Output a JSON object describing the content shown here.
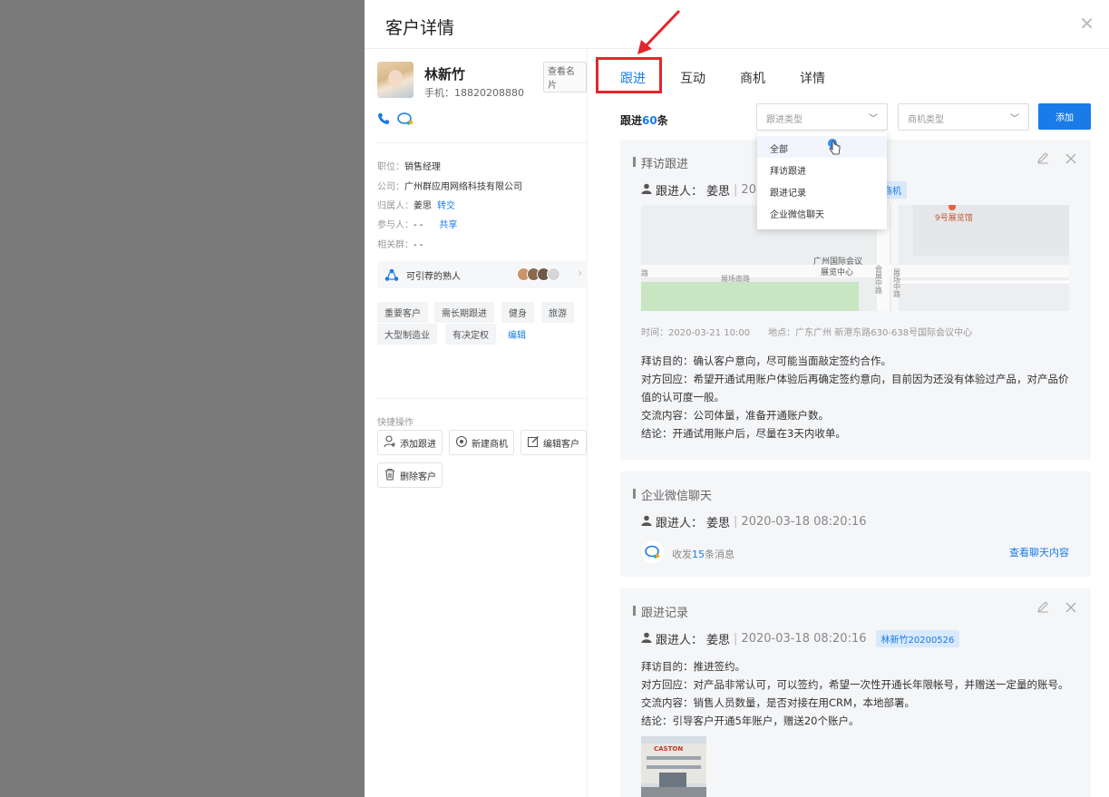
{
  "drawer": {
    "title": "客户详情",
    "close_icon": "close-icon"
  },
  "customer": {
    "name": "林新竹",
    "phone": "手机：18820208880",
    "view_card": "查看名片",
    "fields": [
      {
        "label": "职位：",
        "value": "销售经理"
      },
      {
        "label": "公司：",
        "value": "广州群应用网络科技有限公司"
      },
      {
        "label": "归属人：",
        "value": "姜思",
        "link": "转交"
      },
      {
        "label": "参与人：",
        "value": "- -",
        "link": "共享"
      },
      {
        "label": "相关群：",
        "value": "- -"
      }
    ],
    "recommend_label": "可引荐的熟人",
    "tags": [
      "重要客户",
      "需长期跟进",
      "健身",
      "旅游",
      "大型制造业",
      "有决定权"
    ],
    "tags_edit": "编辑",
    "quick_title": "快捷操作",
    "quick_actions": [
      "添加跟进",
      "新建商机",
      "编辑客户",
      "删除客户"
    ]
  },
  "tabs": [
    "跟进",
    "互动",
    "商机",
    "详情"
  ],
  "follow_count": {
    "prefix": "跟进",
    "num": "60",
    "suffix": "条"
  },
  "filters": {
    "type_placeholder": "跟进类型",
    "biz_placeholder": "商机类型",
    "add_label": "添加",
    "dropdown_options": [
      "全部",
      "拜访跟进",
      "跟进记录",
      "企业微信聊天"
    ]
  },
  "records": [
    {
      "title": "拜访跟进",
      "follower_label": "跟进人：",
      "follower": "姜思",
      "time": "2020",
      "biz_tag": "商机",
      "map_labels": {
        "poi": "9号展览馆",
        "center": "广州国际会议\n展览中心",
        "road1": "展场南路",
        "road2": "会展中路",
        "road3": "展场中路",
        "road4": "路"
      },
      "meta_time": "时间：2020-03-21 10:00",
      "meta_place": "地点：广东广州 新港东路630-638号国际会议中心",
      "lines": [
        "拜访目的：确认客户意向，尽可能当面敲定签约合作。",
        "对方回应：希望开通试用账户体验后再确定签约意向，目前因为还没有体验过产品，对产品价值的认可度一般。",
        "交流内容：公司体量，准备开通账户数。",
        "结论：开通试用账户后，尽量在3天内收单。"
      ]
    },
    {
      "title": "企业微信聊天",
      "follower_label": "跟进人：",
      "follower": "姜思",
      "time": "2020-03-18 08:20:16",
      "chat_prefix": "收发",
      "chat_num": "15",
      "chat_suffix": "条消息",
      "chat_link": "查看聊天内容"
    },
    {
      "title": "跟进记录",
      "follower_label": "跟进人：",
      "follower": "姜思",
      "time": "2020-03-18 08:20:16",
      "biz_tag": "林新竹20200526",
      "lines": [
        "拜访目的：推进签约。",
        "对方回应：对产品非常认可，可以签约，希望一次性开通长年限帐号，并赠送一定量的账号。",
        "交流内容：销售人员数量，是否对接在用CRM，本地部署。",
        "结论：引导客户开通5年账户，赠送20个账户。"
      ],
      "photo_sign": "CASTON"
    }
  ],
  "colors": {
    "accent": "#1a7be8",
    "highlight": "#e3262b",
    "overlay": "#7a7a7a"
  }
}
